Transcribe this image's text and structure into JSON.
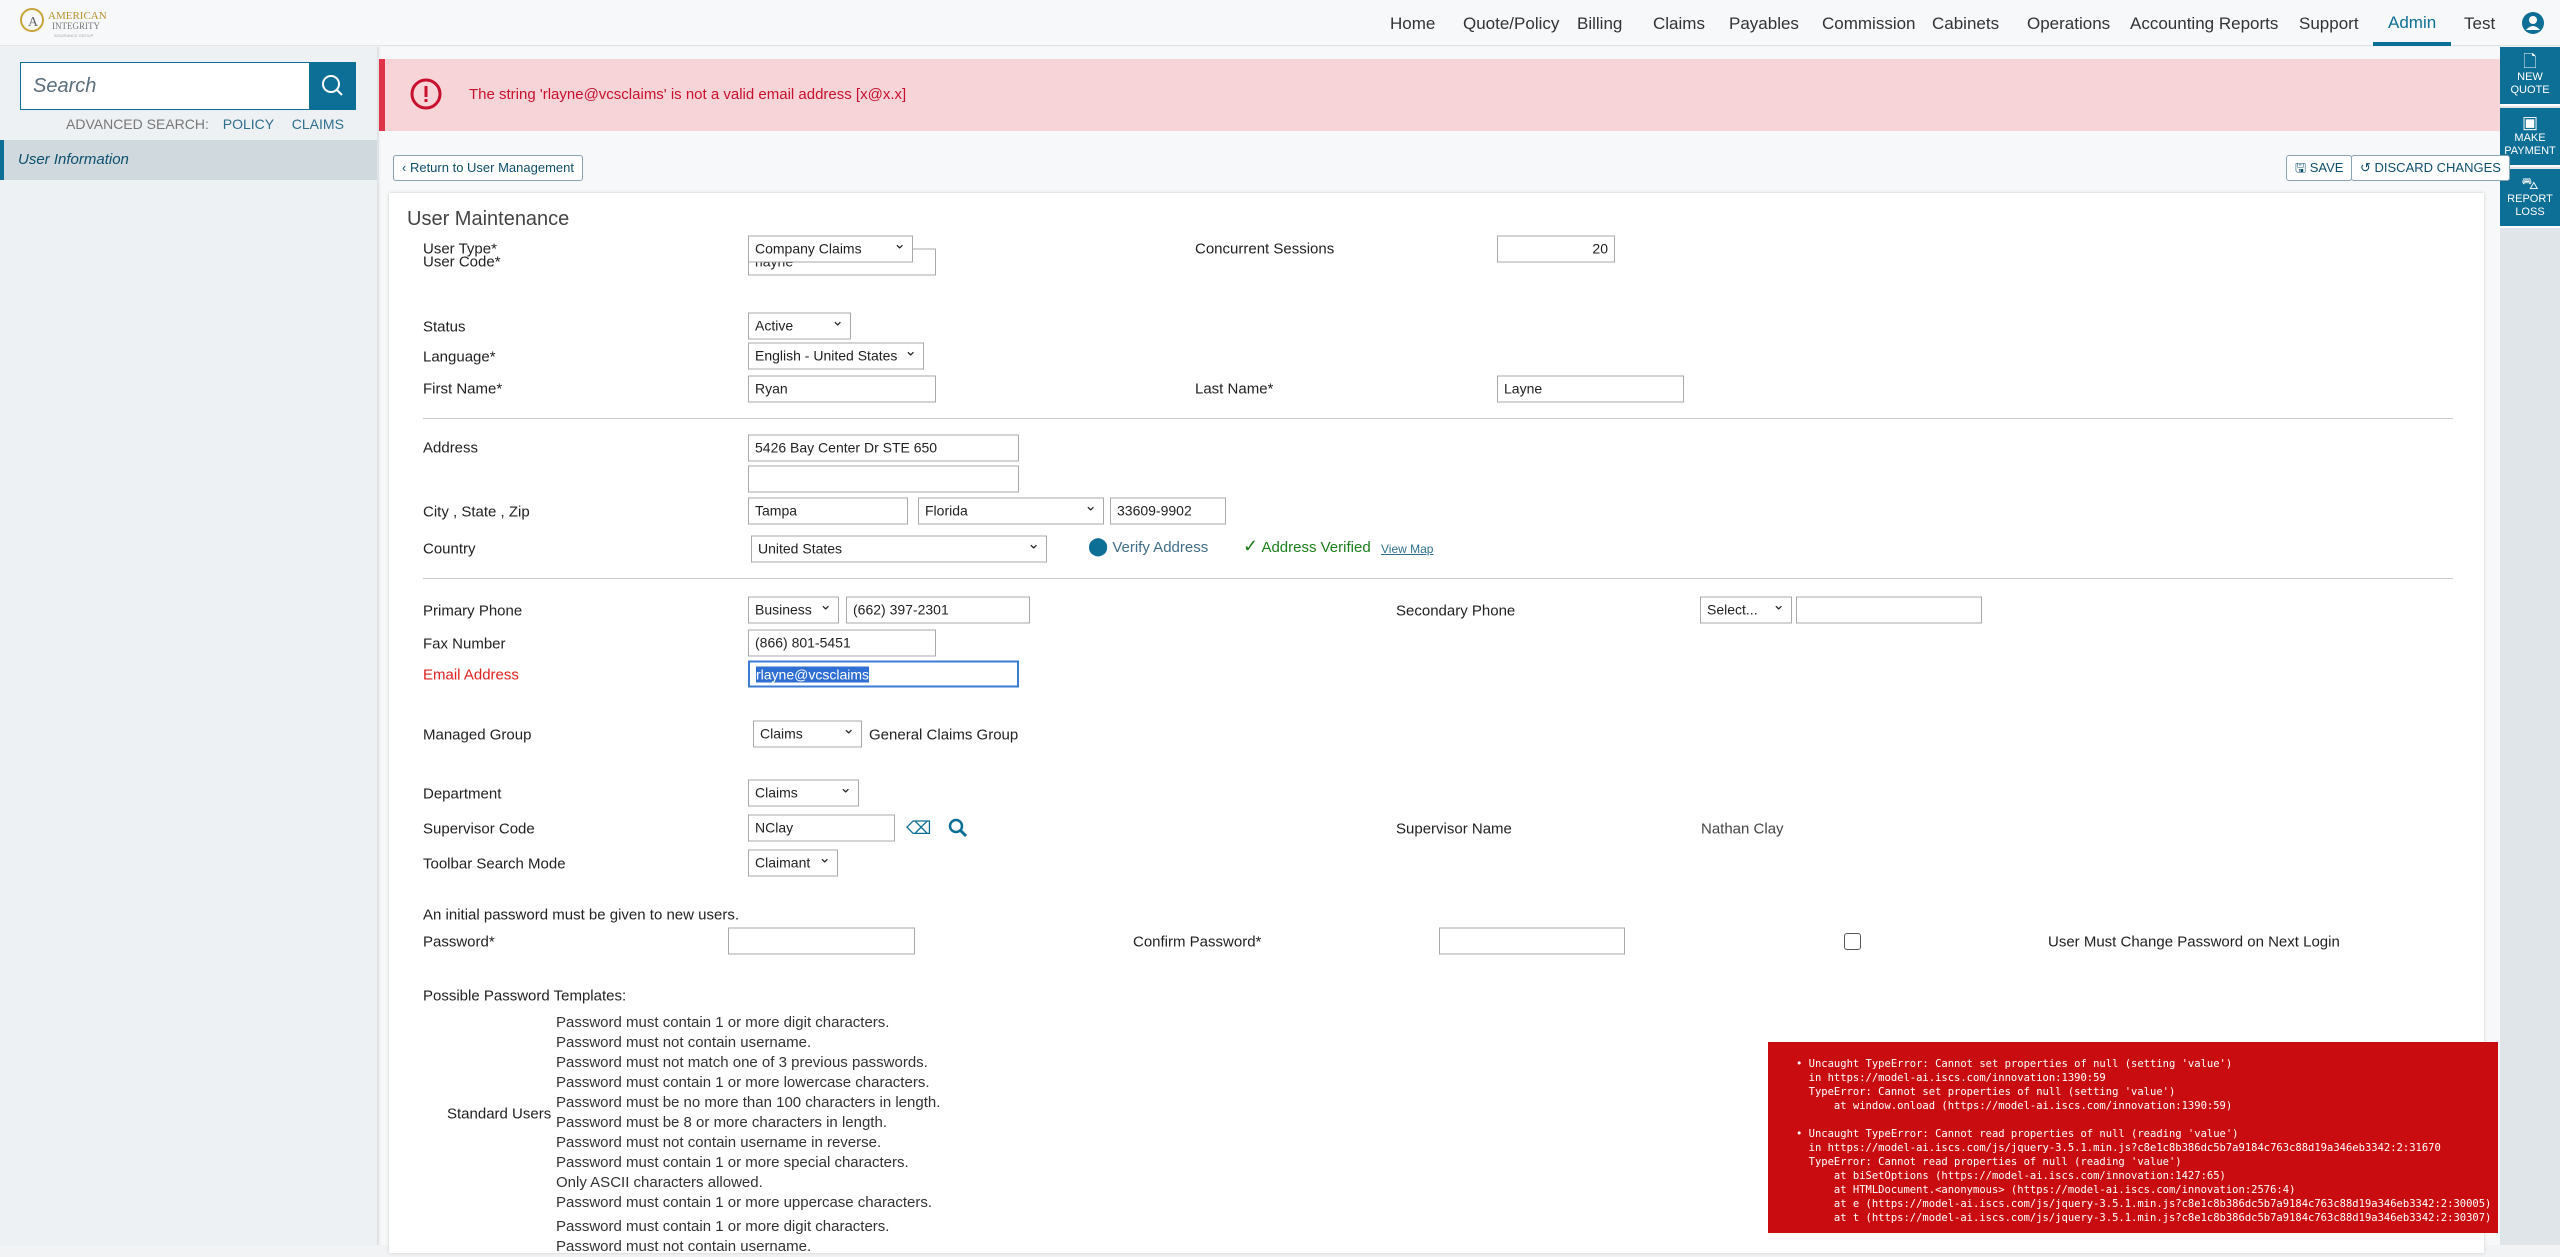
{
  "logo": "AMERICAN INTEGRITY INSURANCE GROUP",
  "nav": [
    "Home",
    "Quote/Policy",
    "Billing",
    "Claims",
    "Payables",
    "Commission",
    "Cabinets",
    "Operations",
    "Accounting Reports",
    "Support",
    "Admin",
    "Test"
  ],
  "nav_active": "Admin",
  "sidebar": {
    "search_placeholder": "Search",
    "advanced_label": "ADVANCED SEARCH:",
    "policy": "POLICY",
    "claims": "CLAIMS",
    "items": [
      {
        "label": "User Information"
      }
    ]
  },
  "right_toolbar": [
    {
      "label1": "NEW",
      "label2": "QUOTE",
      "icon": "new-quote-icon"
    },
    {
      "label1": "MAKE",
      "label2": "PAYMENT",
      "icon": "payment-icon"
    },
    {
      "label1": "REPORT",
      "label2": "LOSS",
      "icon": "car-crash-icon"
    }
  ],
  "banner": {
    "message": "The string 'rlayne@vcsclaims' is not a valid email address [x@x.x]"
  },
  "buttons": {
    "return": "Return to User Management",
    "save": "SAVE",
    "discard": "DISCARD CHANGES"
  },
  "form": {
    "title": "User Maintenance",
    "user_code": {
      "label": "User Code*",
      "value": "rlayne"
    },
    "user_type": {
      "label": "User Type*",
      "value": "Company Claims"
    },
    "concurrent": {
      "label": "Concurrent Sessions",
      "value": "20"
    },
    "status": {
      "label": "Status",
      "value": "Active"
    },
    "language": {
      "label": "Language*",
      "value": "English - United States"
    },
    "first_name": {
      "label": "First Name*",
      "value": "Ryan"
    },
    "last_name": {
      "label": "Last Name*",
      "value": "Layne"
    },
    "address": {
      "label": "Address",
      "line1": "5426 Bay Center Dr STE 650",
      "line2": ""
    },
    "csz": {
      "label": "City , State , Zip",
      "city": "Tampa",
      "state": "Florida",
      "zip": "33609-9902"
    },
    "country": {
      "label": "Country",
      "value": "United States",
      "verify": "Verify Address",
      "verified": "Address Verified",
      "view_map": "View Map"
    },
    "primary_phone": {
      "label": "Primary Phone",
      "type": "Business",
      "value": "(662) 397-2301"
    },
    "secondary_phone": {
      "label": "Secondary Phone",
      "type": "Select...",
      "value": ""
    },
    "fax": {
      "label": "Fax Number",
      "value": "(866) 801-5451"
    },
    "email": {
      "label": "Email Address",
      "value": "rlayne@vcsclaims"
    },
    "managed_group": {
      "label": "Managed Group",
      "value": "Claims",
      "text": "General Claims Group"
    },
    "department": {
      "label": "Department",
      "value": "Claims"
    },
    "supervisor_code": {
      "label": "Supervisor Code",
      "value": "NClay"
    },
    "supervisor_name": {
      "label": "Supervisor Name",
      "value": "Nathan Clay"
    },
    "toolbar_mode": {
      "label": "Toolbar Search Mode",
      "value": "Claimant"
    },
    "pw_note": "An initial password must be given to new users.",
    "password": {
      "label": "Password*",
      "value": ""
    },
    "confirm": {
      "label": "Confirm Password*",
      "value": ""
    },
    "must_change": {
      "label": "User Must Change Password on Next Login",
      "checked": false
    },
    "templates_label": "Possible Password Templates:",
    "standard_users": "Standard Users",
    "rules": [
      "Password must contain 1 or more digit characters.",
      "Password must not contain username.",
      "Password must not match one of 3 previous passwords.",
      "Password must contain 1 or more lowercase characters.",
      "Password must be no more than 100 characters in length.",
      "Password must be 8 or more characters in length.",
      "Password must not contain username in reverse.",
      "Password must contain 1 or more special characters.",
      "Only ASCII characters allowed.",
      "Password must contain 1 or more uppercase characters.",
      "Password must contain 1 or more digit characters.",
      "Password must not contain username."
    ]
  },
  "error_overlay": "• Uncaught TypeError: Cannot set properties of null (setting 'value')\n  in https://model-ai.iscs.com/innovation:1390:59\n  TypeError: Cannot set properties of null (setting 'value')\n      at window.onload (https://model-ai.iscs.com/innovation:1390:59)\n\n• Uncaught TypeError: Cannot read properties of null (reading 'value')\n  in https://model-ai.iscs.com/js/jquery-3.5.1.min.js?c8e1c8b386dc5b7a9184c763c88d19a346eb3342:2:31670\n  TypeError: Cannot read properties of null (reading 'value')\n      at biSetOptions (https://model-ai.iscs.com/innovation:1427:65)\n      at HTMLDocument.<anonymous> (https://model-ai.iscs.com/innovation:2576:4)\n      at e (https://model-ai.iscs.com/js/jquery-3.5.1.min.js?c8e1c8b386dc5b7a9184c763c88d19a346eb3342:2:30005)\n      at t (https://model-ai.iscs.com/js/jquery-3.5.1.min.js?c8e1c8b386dc5b7a9184c763c88d19a346eb3342:2:30307)",
  "colors": {
    "brand": "#0e6f96",
    "error": "#c90c0f",
    "banner": "#f7d4d8",
    "verified": "#1a7f1a"
  }
}
